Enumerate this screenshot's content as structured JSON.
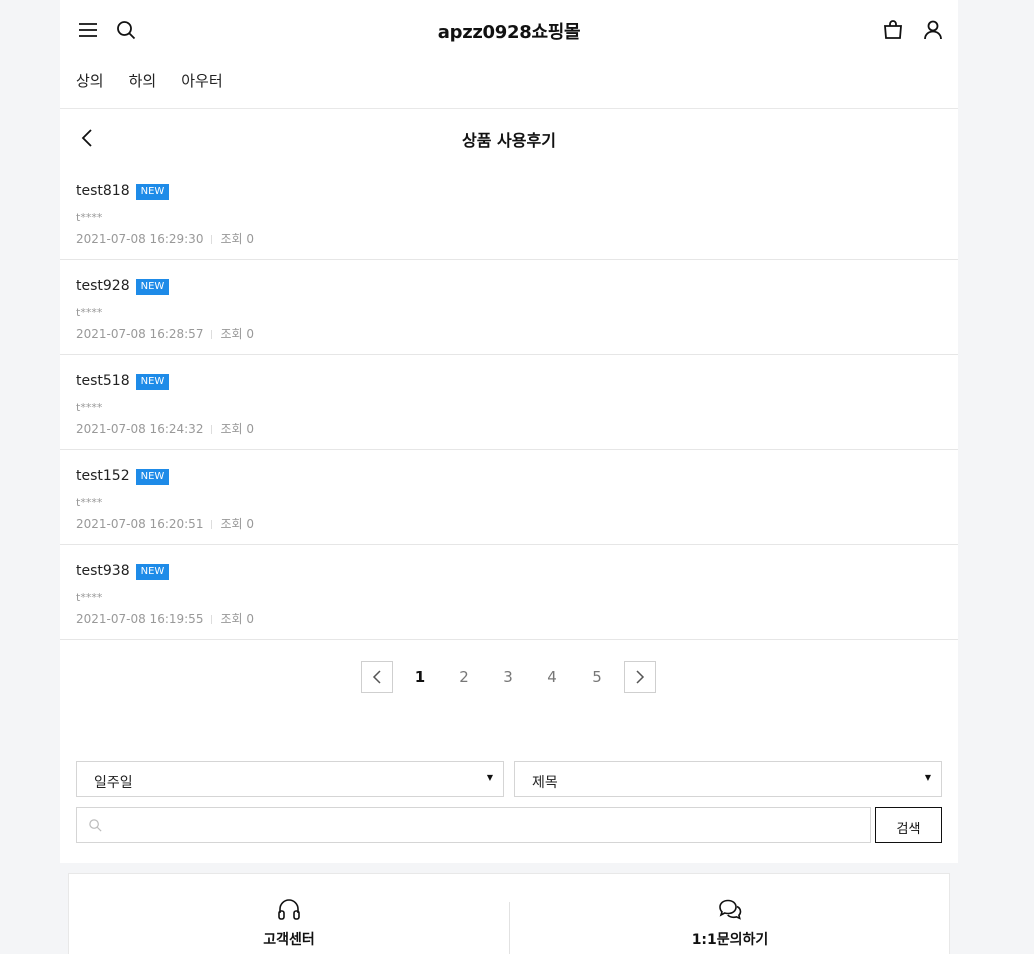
{
  "header": {
    "logo": "apzz0928쇼핑몰",
    "categories": [
      "상의",
      "하의",
      "아우터"
    ]
  },
  "page_title": "상품 사용후기",
  "reviews": [
    {
      "title": "test818",
      "badge": "NEW",
      "author": "t****",
      "date": "2021-07-08 16:29:30",
      "views": "조회 0"
    },
    {
      "title": "test928",
      "badge": "NEW",
      "author": "t****",
      "date": "2021-07-08 16:28:57",
      "views": "조회 0"
    },
    {
      "title": "test518",
      "badge": "NEW",
      "author": "t****",
      "date": "2021-07-08 16:24:32",
      "views": "조회 0"
    },
    {
      "title": "test152",
      "badge": "NEW",
      "author": "t****",
      "date": "2021-07-08 16:20:51",
      "views": "조회 0"
    },
    {
      "title": "test938",
      "badge": "NEW",
      "author": "t****",
      "date": "2021-07-08 16:19:55",
      "views": "조회 0"
    }
  ],
  "pagination": {
    "pages": [
      "1",
      "2",
      "3",
      "4",
      "5"
    ],
    "current": "1"
  },
  "search": {
    "period_select": "일주일",
    "field_select": "제목",
    "input_value": "",
    "button_label": "검색"
  },
  "footer": {
    "customer_center_label": "고객센터",
    "inquiry_label": "1:1문의하기"
  },
  "colors": {
    "badge": "#1e8be8",
    "background": "#f4f5f7"
  }
}
